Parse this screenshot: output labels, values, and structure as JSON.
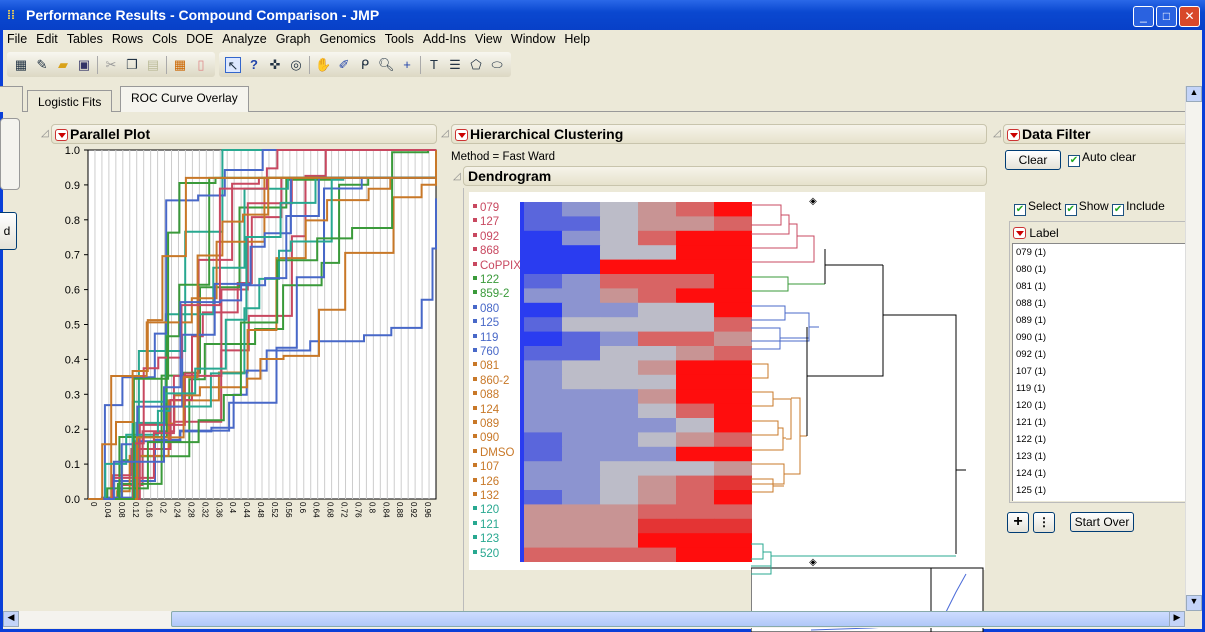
{
  "window": {
    "title": "Performance Results - Compound Comparison - JMP"
  },
  "menu": [
    "File",
    "Edit",
    "Tables",
    "Rows",
    "Cols",
    "DOE",
    "Analyze",
    "Graph",
    "Genomics",
    "Tools",
    "Add-Ins",
    "View",
    "Window",
    "Help"
  ],
  "tabs": [
    {
      "label": "Logistic Fits"
    },
    {
      "label": "ROC Curve Overlay"
    }
  ],
  "side_stub": "d",
  "parallel": {
    "title": "Parallel Plot",
    "yticks": [
      "1.0",
      "0.9",
      "0.8",
      "0.7",
      "0.6",
      "0.5",
      "0.4",
      "0.3",
      "0.2",
      "0.1",
      "0.0"
    ],
    "xticks": [
      "0",
      "0.04",
      "0.08",
      "0.12",
      "0.16",
      "0.2",
      "0.24",
      "0.28",
      "0.32",
      "0.36",
      "0.4",
      "0.44",
      "0.48",
      "0.52",
      "0.56",
      "0.6",
      "0.64",
      "0.68",
      "0.72",
      "0.76",
      "0.8",
      "0.84",
      "0.88",
      "0.92",
      "0.96"
    ]
  },
  "clustering": {
    "title": "Hierarchical Clustering",
    "method": "Method = Fast Ward",
    "dendrogram_title": "Dendrogram",
    "rows": [
      {
        "label": "079",
        "group": "red",
        "cells": "blgprF"
      },
      {
        "label": "127",
        "group": "red",
        "cells": "bbgppr"
      },
      {
        "label": "092",
        "group": "red",
        "cells": "BlgrFF"
      },
      {
        "label": "868",
        "group": "red",
        "cells": "BBggFF"
      },
      {
        "label": "CoPPIX",
        "group": "red",
        "cells": "BBFFFF"
      },
      {
        "label": "122",
        "group": "green",
        "cells": "blrrrF"
      },
      {
        "label": "859-2",
        "group": "green",
        "cells": "llprFF"
      },
      {
        "label": "080",
        "group": "blue",
        "cells": "BllggF"
      },
      {
        "label": "125",
        "group": "blue",
        "cells": "bggggr"
      },
      {
        "label": "119",
        "group": "blue",
        "cells": "Bblrrp"
      },
      {
        "label": "760",
        "group": "blue",
        "cells": "bbggpr"
      },
      {
        "label": "081",
        "group": "orange",
        "cells": "lggpFF"
      },
      {
        "label": "860-2",
        "group": "orange",
        "cells": "lgggFF"
      },
      {
        "label": "088",
        "group": "orange",
        "cells": "lllpFF"
      },
      {
        "label": "124",
        "group": "orange",
        "cells": "lllgrF"
      },
      {
        "label": "089",
        "group": "orange",
        "cells": "llllgF"
      },
      {
        "label": "090",
        "group": "orange",
        "cells": "bllgpr"
      },
      {
        "label": "DMSO",
        "group": "orange",
        "cells": "blllFF"
      },
      {
        "label": "107",
        "group": "orange",
        "cells": "llgggp"
      },
      {
        "label": "126",
        "group": "orange",
        "cells": "llgprR"
      },
      {
        "label": "132",
        "group": "orange",
        "cells": "blgprF"
      },
      {
        "label": "120",
        "group": "teal",
        "cells": "ppprrr"
      },
      {
        "label": "121",
        "group": "teal",
        "cells": "pppRRR"
      },
      {
        "label": "123",
        "group": "teal",
        "cells": "pppFFF"
      },
      {
        "label": "520",
        "group": "teal",
        "cells": "rrrrFF"
      }
    ]
  },
  "group_colors": {
    "red": "#c84860",
    "green": "#3a9a3a",
    "blue": "#4868c8",
    "orange": "#c87828",
    "teal": "#28a890"
  },
  "heat_colors": {
    "B": "#2a3cf0",
    "b": "#5a66dc",
    "l": "#8c94d0",
    "g": "#bcbcc8",
    "p": "#c89494",
    "r": "#d86464",
    "R": "#e43434",
    "F": "#ff0d0d"
  },
  "filter": {
    "title": "Data Filter",
    "clear": "Clear",
    "auto_clear": "Auto clear",
    "select": "Select",
    "show": "Show",
    "include": "Include",
    "column": "Label",
    "items": [
      "079 (1)",
      "080 (1)",
      "081 (1)",
      "088 (1)",
      "089 (1)",
      "090 (1)",
      "092 (1)",
      "107 (1)",
      "119 (1)",
      "120 (1)",
      "121 (1)",
      "122 (1)",
      "123 (1)",
      "124 (1)",
      "125 (1)"
    ],
    "start_over": "Start Over"
  }
}
